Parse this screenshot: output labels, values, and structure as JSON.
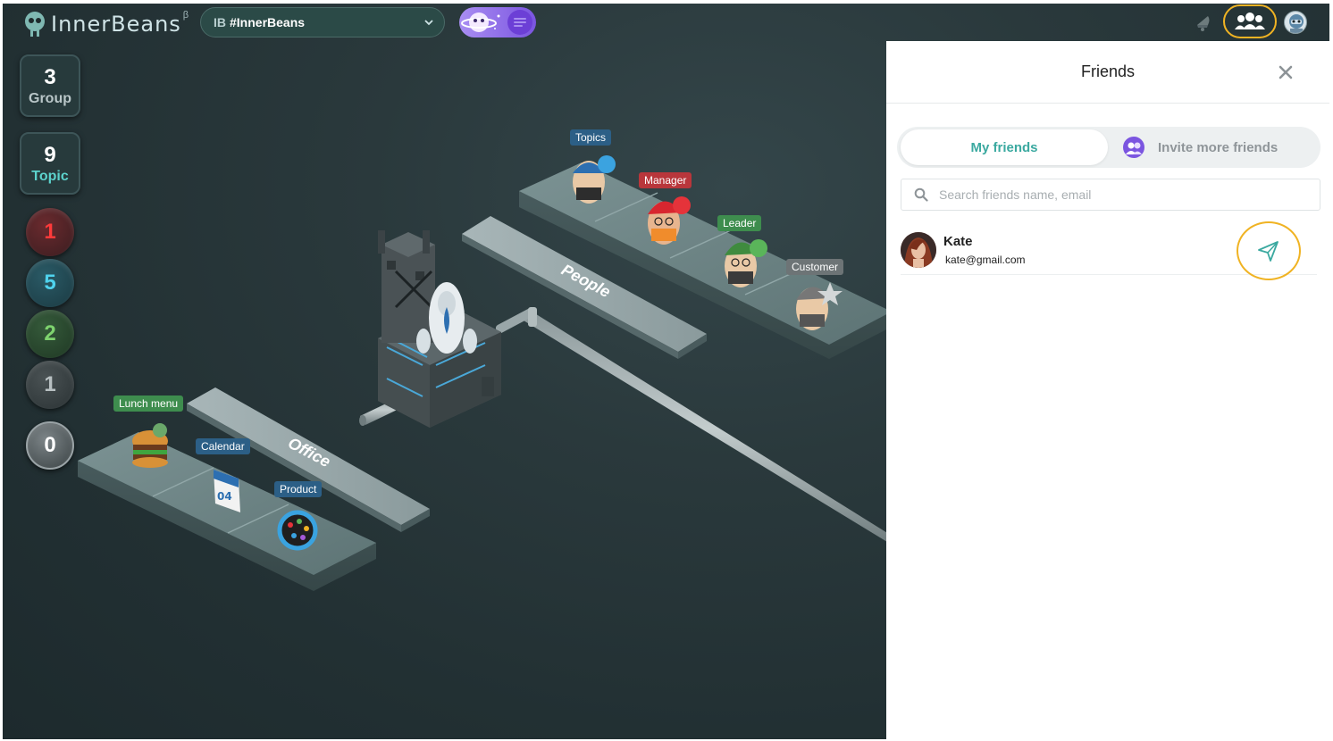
{
  "app": {
    "name": "InnerBeans",
    "beta_mark": "β"
  },
  "channel": {
    "prefix": "IB",
    "name": "#InnerBeans"
  },
  "counters": {
    "group": {
      "value": "3",
      "label": "Group"
    },
    "topic": {
      "value": "9",
      "label": "Topic"
    },
    "orbs": [
      "1",
      "5",
      "2",
      "1",
      "0"
    ]
  },
  "scene": {
    "tags": {
      "topics": "Topics",
      "manager": "Manager",
      "leader": "Leader",
      "customer": "Customer",
      "lunch_menu": "Lunch menu",
      "calendar": "Calendar",
      "product": "Product"
    },
    "zones": {
      "people": "People",
      "office": "Office"
    }
  },
  "friends_panel": {
    "title": "Friends",
    "tabs": {
      "my_friends": "My friends",
      "invite": "Invite more friends"
    },
    "search_placeholder": "Search friends name, email",
    "friends": [
      {
        "name": "Kate",
        "email": "kate@gmail.com"
      }
    ]
  },
  "colors": {
    "accent_teal": "#3ba9a0",
    "highlight_ring": "#f0b323",
    "space_purple": "#7b55e0"
  }
}
